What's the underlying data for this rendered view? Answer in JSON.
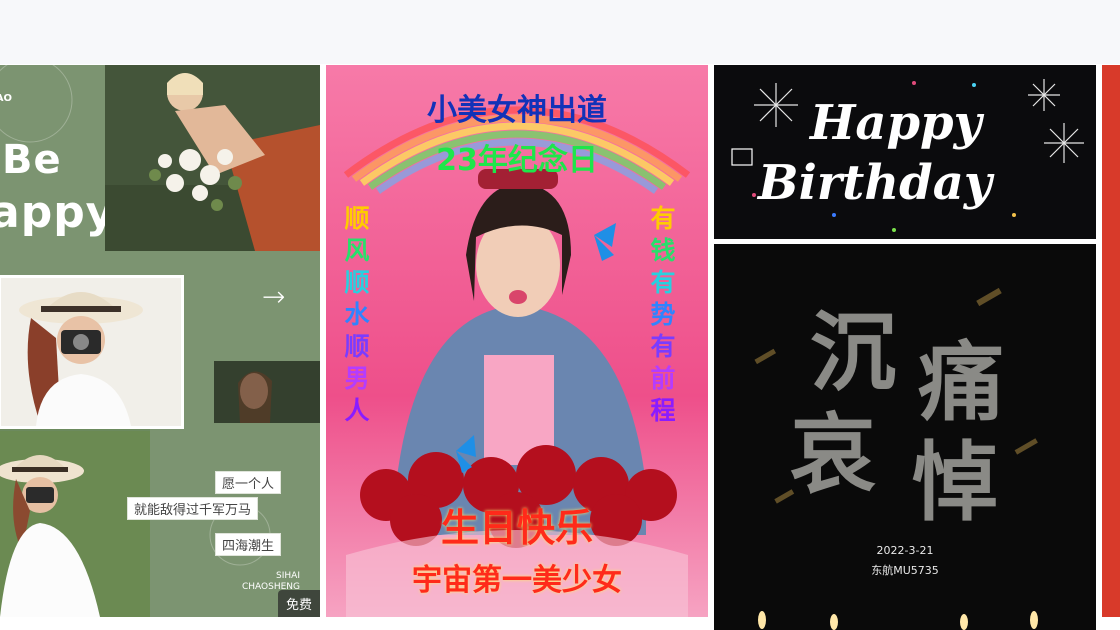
{
  "card1": {
    "brand_tag": "CHAO\nG",
    "line1": "Be",
    "line2": "appy",
    "arrow": "→",
    "quote1": "愿一个人",
    "quote2": "就能敌得过千军万马",
    "quote3": "四海潮生",
    "sihai": "SIHAI\nCHAOSHENG",
    "badge": "免费"
  },
  "card2": {
    "title1": "小美女神出道",
    "title2": "23年纪念日",
    "left_vertical": [
      "顺",
      "风",
      "顺",
      "水",
      "顺",
      "男",
      "人"
    ],
    "right_vertical": [
      "有",
      "钱",
      "有",
      "势",
      "有",
      "前",
      "程"
    ],
    "bottom1": "生日快乐",
    "bottom2": "宇宙第一美少女"
  },
  "card3": {
    "line1": "Happy",
    "line2": "Birthday"
  },
  "card4": {
    "chars": [
      "沉",
      "痛",
      "哀",
      "悼"
    ],
    "date": "2022-3-21",
    "flight": "东航MU5735"
  },
  "colors": {
    "green": "#7c9471",
    "pink": "#f25a95",
    "black": "#0b0b0d",
    "red": "#d83a2a"
  }
}
